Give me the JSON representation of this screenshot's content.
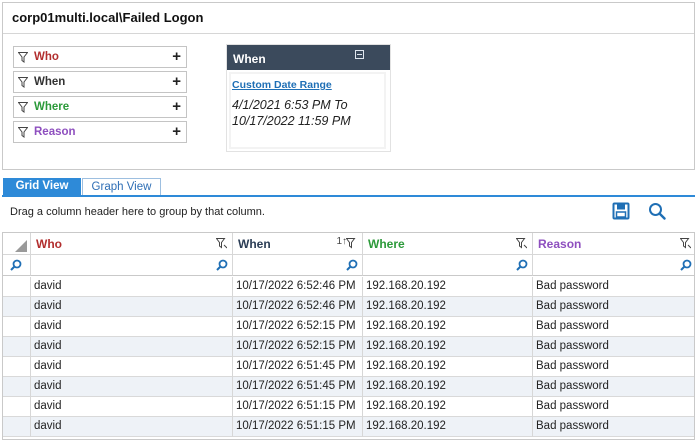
{
  "title": "corp01multi.local\\Failed Logon",
  "filters": [
    {
      "label": "Who",
      "color": "#b22e2e"
    },
    {
      "label": "When",
      "color": "#333333"
    },
    {
      "label": "Where",
      "color": "#2c9a3a"
    },
    {
      "label": "Reason",
      "color": "#8e4fbf"
    }
  ],
  "filter_add_glyph": "+",
  "when_card": {
    "header": "When",
    "link": "Custom Date Range",
    "range_line1": "4/1/2021 6:53 PM To",
    "range_line2": "10/17/2022 11:59 PM"
  },
  "tabs": [
    {
      "label": "Grid View",
      "active": true
    },
    {
      "label": "Graph View",
      "active": false
    }
  ],
  "group_hint": "Drag a column header here to group by that column.",
  "columns": [
    {
      "label": "Who",
      "color": "#b22e2e"
    },
    {
      "label": "When",
      "color": "#2b3d55",
      "sort": "1↑"
    },
    {
      "label": "Where",
      "color": "#2c9a3a"
    },
    {
      "label": "Reason",
      "color": "#8e4fbf"
    }
  ],
  "rows": [
    [
      "david",
      "10/17/2022 6:52:46 PM",
      "192.168.20.192",
      "Bad password"
    ],
    [
      "david",
      "10/17/2022 6:52:46 PM",
      "192.168.20.192",
      "Bad password"
    ],
    [
      "david",
      "10/17/2022 6:52:15 PM",
      "192.168.20.192",
      "Bad password"
    ],
    [
      "david",
      "10/17/2022 6:52:15 PM",
      "192.168.20.192",
      "Bad password"
    ],
    [
      "david",
      "10/17/2022 6:51:45 PM",
      "192.168.20.192",
      "Bad password"
    ],
    [
      "david",
      "10/17/2022 6:51:45 PM",
      "192.168.20.192",
      "Bad password"
    ],
    [
      "david",
      "10/17/2022 6:51:15 PM",
      "192.168.20.192",
      "Bad password"
    ],
    [
      "david",
      "10/17/2022 6:51:15 PM",
      "192.168.20.192",
      "Bad password"
    ]
  ],
  "icons": {
    "funnel": "funnel-icon",
    "save": "save-icon",
    "search": "search-icon",
    "collapse": "collapse-icon"
  },
  "accent": "#2e8ad8"
}
